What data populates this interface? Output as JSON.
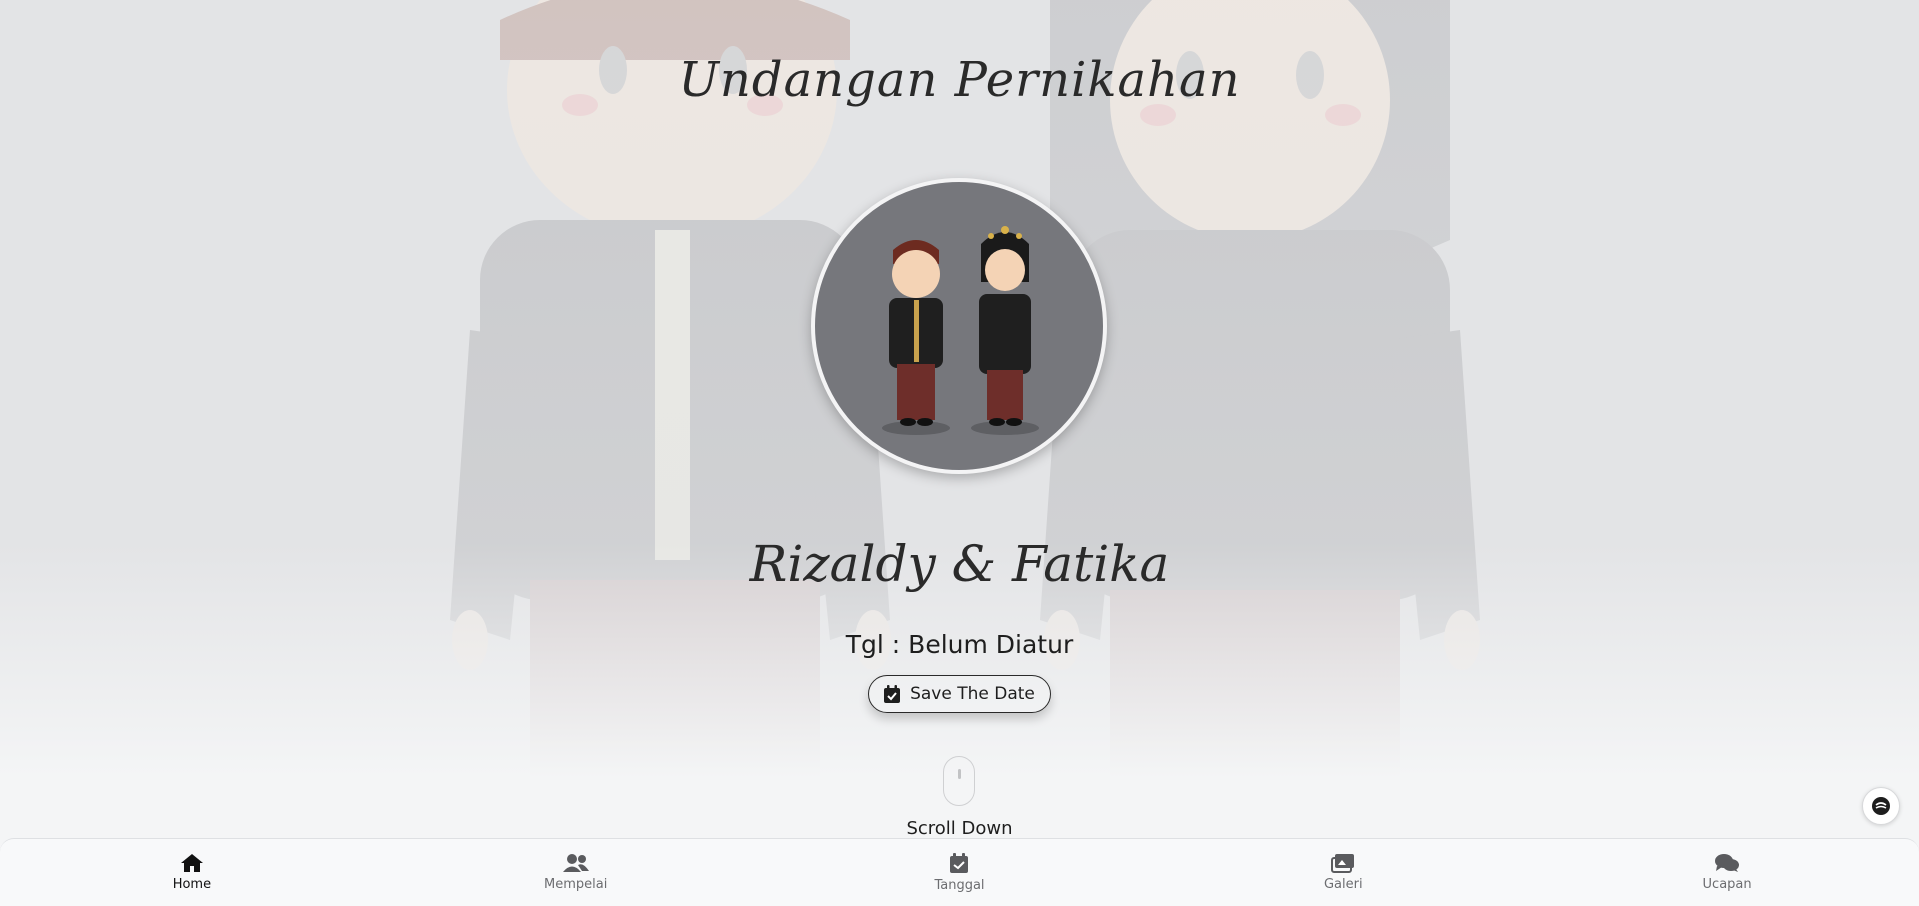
{
  "hero": {
    "title": "Undangan Pernikahan",
    "couple_names": "Rizaldy & Fatika",
    "date_text": "Tgl : Belum Diatur",
    "save_button_label": "Save The Date",
    "scroll_label": "Scroll Down"
  },
  "bottom_nav": {
    "items": [
      {
        "label": "Home",
        "icon": "home-icon",
        "active": true
      },
      {
        "label": "Mempelai",
        "icon": "users-icon",
        "active": false
      },
      {
        "label": "Tanggal",
        "icon": "calendar-check-icon",
        "active": false
      },
      {
        "label": "Galeri",
        "icon": "images-icon",
        "active": false
      },
      {
        "label": "Ucapan",
        "icon": "comments-icon",
        "active": false
      }
    ]
  },
  "colors": {
    "background": "#e3e4e6",
    "text": "#222222",
    "avatar_bg": "#76777c",
    "nav_bg": "#f8f9fa"
  }
}
